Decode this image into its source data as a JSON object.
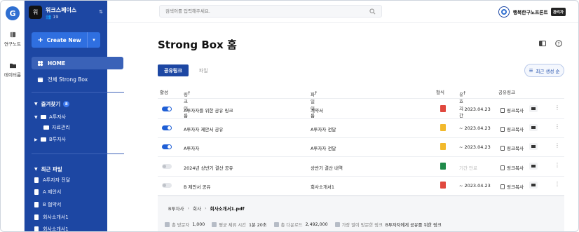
{
  "rail": {
    "items": [
      {
        "label": "연구노트",
        "icon": "book-icon"
      },
      {
        "label": "데이터룸",
        "icon": "folder-icon"
      }
    ]
  },
  "workspace": {
    "avatar_letter": "워",
    "name": "워크스페이스",
    "members": "19"
  },
  "sidebar": {
    "create_label": "Create New",
    "home_label": "HOME",
    "all_label": "전체 Strong Box",
    "favorites_label": "즐겨찾기",
    "favorites_count": "8",
    "tree": [
      {
        "label": "A투자사",
        "expanded": true
      },
      {
        "label": "자료관리",
        "child": true
      },
      {
        "label": "B투자사",
        "expanded": false
      }
    ],
    "recent_label": "최근 파일",
    "recent_files": [
      "A투자자 전달",
      "A 제안서",
      "B 협약서",
      "회사소개서1",
      "회사소개서1"
    ]
  },
  "topbar": {
    "search_placeholder": "검색어를 입력해주세요.",
    "user_name": "행복한구노프론트",
    "user_role": "관리자"
  },
  "page": {
    "title": "Strong Box 홈",
    "tabs": [
      "공유링크",
      "파일"
    ],
    "sort_label": "최근 생성 순"
  },
  "table": {
    "headers": {
      "active": "활성",
      "link_name": "링크이름",
      "file_name": "파일이름",
      "format": "형식",
      "expiry": "유효기간",
      "share": "공유링크"
    },
    "rows": [
      {
        "active": true,
        "link_name": "A투자자를 위한 공유 링크",
        "file_name": "계약서",
        "format": "pdf",
        "expiry": "~ 2023.04.23",
        "expired": false,
        "copy": "링크복사"
      },
      {
        "active": true,
        "link_name": "A투자자 제안서 공유",
        "file_name": "A투자자 전달",
        "format": "ppt",
        "expiry": "~ 2023.04.23",
        "expired": false,
        "copy": "링크복사"
      },
      {
        "active": true,
        "link_name": "A투자자",
        "file_name": "A투자자 전달",
        "format": "ppt",
        "expiry": "~ 2023.04.23",
        "expired": false,
        "copy": "링크복사"
      },
      {
        "active": false,
        "link_name": "2024년 상반기 결산 공유",
        "file_name": "상반기 결산 내역",
        "format": "xls",
        "expiry": "기간 만료",
        "expired": true,
        "copy": "링크복사"
      },
      {
        "active": false,
        "link_name": "B 제안서 공유",
        "file_name": "회사소개서1",
        "format": "pdf",
        "expiry": "~ 2023.04.23",
        "expired": false,
        "copy": "링크복사"
      }
    ]
  },
  "detail": {
    "breadcrumb": [
      "B투자사",
      "회사",
      "회사소개서1.pdf"
    ],
    "stats": [
      {
        "label": "총 방문자",
        "value": "1,000"
      },
      {
        "label": "평균 체류 시간",
        "value": "1분 20초"
      },
      {
        "label": "총 다운로드",
        "value": "2,492,000"
      },
      {
        "label": "가장 많이 방문한 링크",
        "value": "B투자자에게 공유를 위한 링크"
      }
    ]
  },
  "colors": {
    "sidebar": "#1d47a3",
    "primary": "#1d47a3",
    "toggle_on": "#1f5fd6",
    "pdf": "#e0483e",
    "ppt": "#f2b92c",
    "xls": "#1f8a49"
  }
}
